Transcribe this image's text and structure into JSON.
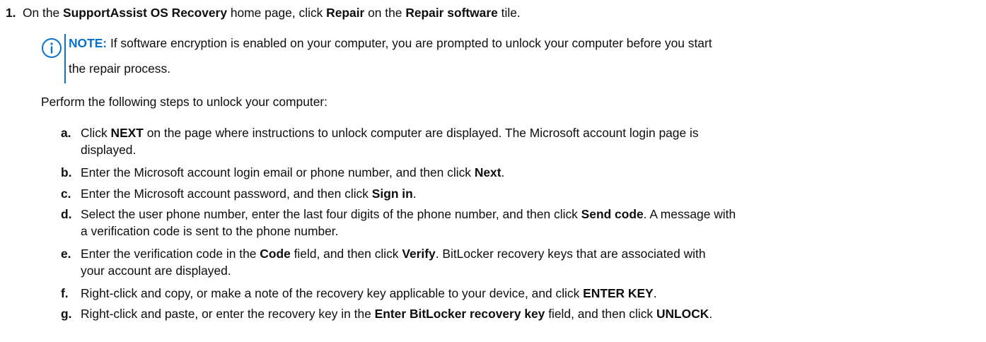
{
  "step1": {
    "number": "1.",
    "text": {
      "p1": "On the ",
      "b1": "SupportAssist OS Recovery",
      "p2": " home page, click ",
      "b2": "Repair",
      "p3": " on the ",
      "b3": "Repair software",
      "p4": " tile."
    }
  },
  "note": {
    "label": "NOTE:",
    "line1": " If software encryption is enabled on your computer, you are prompted to unlock your computer before you start",
    "line2": "the repair process.",
    "icon": "info-icon",
    "accent_color": "#0672cb"
  },
  "intro": "Perform the following steps to unlock your computer:",
  "substeps": {
    "a": {
      "letter": "a.",
      "p1": "Click ",
      "b1": "NEXT",
      "p2": " on the page where instructions to unlock computer are displayed. The Microsoft account login page is",
      "line2": "displayed."
    },
    "b": {
      "letter": "b.",
      "p1": "Enter the Microsoft account login email or phone number, and then click ",
      "b1": "Next",
      "p2": "."
    },
    "c": {
      "letter": "c.",
      "p1": "Enter the Microsoft account password, and then click ",
      "b1": "Sign in",
      "p2": "."
    },
    "d": {
      "letter": "d.",
      "p1": "Select the user phone number, enter the last four digits of the phone number, and then click ",
      "b1": "Send code",
      "p2": ". A message with",
      "line2": "a verification code is sent to the phone number."
    },
    "e": {
      "letter": "e.",
      "p1": "Enter the verification code in the ",
      "b1": "Code",
      "p2": " field, and then click ",
      "b2": "Verify",
      "p3": ". BitLocker recovery keys that are associated with",
      "line2": "your account are displayed."
    },
    "f": {
      "letter": "f.",
      "p1": "Right-click and copy, or make a note of the recovery key applicable to your device, and click ",
      "b1": "ENTER KEY",
      "p2": "."
    },
    "g": {
      "letter": "g.",
      "p1": "Right-click and paste, or enter the recovery key in the ",
      "b1": "Enter BitLocker recovery key",
      "p2": " field, and then click ",
      "b2": "UNLOCK",
      "p3": "."
    }
  }
}
